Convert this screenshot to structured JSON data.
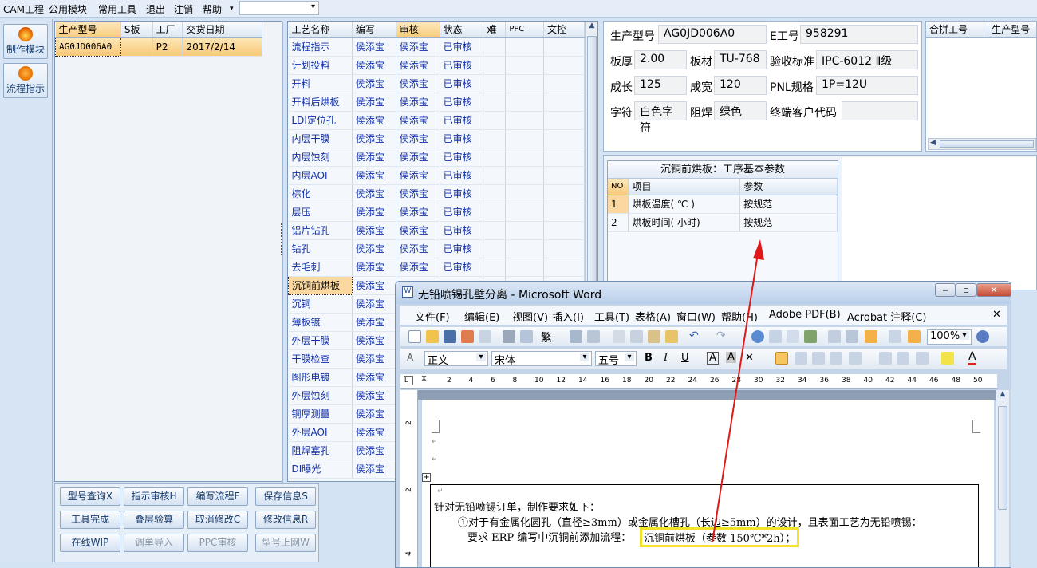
{
  "menubar": {
    "items": [
      "CAM工程",
      "公用模块",
      "常用工具",
      "退出",
      "注销",
      "帮助"
    ]
  },
  "leftbar": {
    "btn1": "制作模块",
    "btn2": "流程指示"
  },
  "orders": {
    "headers": [
      "生产型号",
      "S板",
      "工厂",
      "交货日期"
    ],
    "row": {
      "model": "AG0JD006A0",
      "s": "",
      "factory": "P2",
      "date": "2017/2/14"
    }
  },
  "process": {
    "headers": [
      "工艺名称",
      "编写",
      "审核",
      "状态",
      "难",
      "PPC",
      "文控"
    ],
    "rows": [
      {
        "name": "流程指示",
        "writer": "侯添宝",
        "reviewer": "侯添宝",
        "status": "已审核"
      },
      {
        "name": "计划投料",
        "writer": "侯添宝",
        "reviewer": "侯添宝",
        "status": "已审核"
      },
      {
        "name": "开料",
        "writer": "侯添宝",
        "reviewer": "侯添宝",
        "status": "已审核"
      },
      {
        "name": "开料后烘板",
        "writer": "侯添宝",
        "reviewer": "侯添宝",
        "status": "已审核"
      },
      {
        "name": "LDI定位孔",
        "writer": "侯添宝",
        "reviewer": "侯添宝",
        "status": "已审核"
      },
      {
        "name": "内层干膜",
        "writer": "侯添宝",
        "reviewer": "侯添宝",
        "status": "已审核"
      },
      {
        "name": "内层蚀刻",
        "writer": "侯添宝",
        "reviewer": "侯添宝",
        "status": "已审核"
      },
      {
        "name": "内层AOI",
        "writer": "侯添宝",
        "reviewer": "侯添宝",
        "status": "已审核"
      },
      {
        "name": "棕化",
        "writer": "侯添宝",
        "reviewer": "侯添宝",
        "status": "已审核"
      },
      {
        "name": "层压",
        "writer": "侯添宝",
        "reviewer": "侯添宝",
        "status": "已审核"
      },
      {
        "name": "铝片钻孔",
        "writer": "侯添宝",
        "reviewer": "侯添宝",
        "status": "已审核"
      },
      {
        "name": "钻孔",
        "writer": "侯添宝",
        "reviewer": "侯添宝",
        "status": "已审核"
      },
      {
        "name": "去毛刺",
        "writer": "侯添宝",
        "reviewer": "侯添宝",
        "status": "已审核"
      },
      {
        "name": "沉铜前烘板",
        "writer": "侯添宝",
        "reviewer": "",
        "status": ""
      },
      {
        "name": "沉铜",
        "writer": "侯添宝",
        "reviewer": "",
        "status": ""
      },
      {
        "name": "薄板镀",
        "writer": "侯添宝",
        "reviewer": "",
        "status": ""
      },
      {
        "name": "外层干膜",
        "writer": "侯添宝",
        "reviewer": "",
        "status": ""
      },
      {
        "name": "干膜检查",
        "writer": "侯添宝",
        "reviewer": "",
        "status": ""
      },
      {
        "name": "图形电镀",
        "writer": "侯添宝",
        "reviewer": "",
        "status": ""
      },
      {
        "name": "外层蚀刻",
        "writer": "侯添宝",
        "reviewer": "",
        "status": ""
      },
      {
        "name": "铜厚测量",
        "writer": "侯添宝",
        "reviewer": "",
        "status": ""
      },
      {
        "name": "外层AOI",
        "writer": "侯添宝",
        "reviewer": "",
        "status": ""
      },
      {
        "name": "阻焊塞孔",
        "writer": "侯添宝",
        "reviewer": "",
        "status": ""
      },
      {
        "name": "DI曝光",
        "writer": "侯添宝",
        "reviewer": "",
        "status": ""
      }
    ]
  },
  "info": {
    "model_label": "生产型号",
    "model": "AG0JD006A0",
    "eno_label": "E工号",
    "eno": "958291",
    "thick_label": "板厚",
    "thick": "2.00",
    "material_label": "板材",
    "material": "TU-768",
    "std_label": "验收标准",
    "std": "IPC-6012 Ⅱ级",
    "len_label": "成长",
    "len": "125",
    "wid_label": "成宽",
    "wid": "120",
    "pnl_label": "PNL规格",
    "pnl": "1P=12U",
    "char_label": "字符",
    "char": "白色字符",
    "mask_label": "阻焊",
    "mask": "绿色",
    "cust_label": "终端客户代码",
    "cust": ""
  },
  "merge": {
    "headers": [
      "合拼工号",
      "生产型号"
    ]
  },
  "params": {
    "title": "沉铜前烘板：工序基本参数",
    "headers": [
      "NO",
      "项目",
      "参数"
    ],
    "rows": [
      {
        "no": "1",
        "item": "烘板温度( ℃ )",
        "val": "按规范"
      },
      {
        "no": "2",
        "item": "烘板时间( 小时)",
        "val": "按规范"
      }
    ]
  },
  "buttons": [
    "型号查询X",
    "指示审核H",
    "编写流程F",
    "保存信息S",
    "工具完成",
    "叠层验算",
    "取消修改C",
    "修改信息R",
    "在线WIP",
    "调单导入",
    "PPC审核",
    "型号上网W"
  ],
  "word": {
    "title": "无铅喷锡孔壁分离 - Microsoft Word",
    "menu": [
      "文件(F)",
      "编辑(E)",
      "视图(V)",
      "插入(I)",
      "工具(T)",
      "表格(A)",
      "窗口(W)",
      "帮助(H)",
      "Adobe PDF(B)",
      "Acrobat 注释(C)"
    ],
    "style": "正文",
    "font": "宋体",
    "size": "五号",
    "zoom": "100%",
    "ruler": [
      "2",
      "4",
      "6",
      "8",
      "10",
      "12",
      "14",
      "16",
      "18",
      "20",
      "22",
      "24",
      "26",
      "28",
      "30",
      "32",
      "34",
      "36",
      "38",
      "40",
      "42",
      "44",
      "46",
      "48",
      "50"
    ],
    "line1": "针对无铅喷锡订单，制作要求如下：",
    "line2": "①对于有金属化圆孔（直径≥3mm）或金属化槽孔（长边≥5mm）的设计，且表面工艺为无铅喷锡：",
    "line3": "要求 ERP 编写中沉铜前添加流程：",
    "highlight": "沉铜前烘板（参数 150℃*2h）；"
  }
}
